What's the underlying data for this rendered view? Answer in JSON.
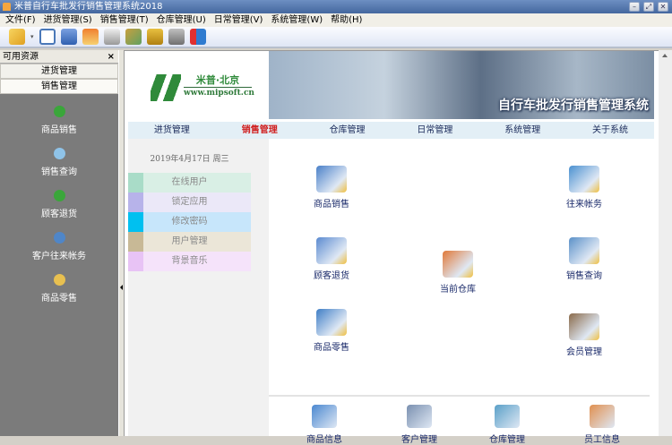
{
  "window": {
    "title": "米普自行车批发行销售管理系统2018",
    "min": "–",
    "max": "⤢",
    "close": "✕"
  },
  "menu": [
    "文件(F)",
    "进货管理(S)",
    "销售管理(T)",
    "仓库管理(U)",
    "日常管理(V)",
    "系统管理(W)",
    "帮助(H)"
  ],
  "toolbar": [
    "open-folder-icon",
    "list-icon",
    "computers-icon",
    "home-icon",
    "printer-icon",
    "keys-icon",
    "lock-icon",
    "user-lock-icon",
    "exit-door-icon"
  ],
  "leftpanel": {
    "title": "可用资源",
    "close": "×",
    "categories": [
      "进货管理",
      "销售管理"
    ],
    "items": [
      {
        "label": "商品销售",
        "color": "#3aa63a"
      },
      {
        "label": "销售查询",
        "color": "#8fc3e8"
      },
      {
        "label": "顾客退货",
        "color": "#3aa63a"
      },
      {
        "label": "客户往来帐务",
        "color": "#4f86c8"
      },
      {
        "label": "商品零售",
        "color": "#e8c050"
      }
    ]
  },
  "logo": {
    "name": "米普·北京",
    "url": "www.mipsoft.cn"
  },
  "banner": {
    "title": "自行车批发行销售管理系统"
  },
  "nav": [
    {
      "label": "进货管理"
    },
    {
      "label": "销售管理",
      "active": true
    },
    {
      "label": "仓库管理"
    },
    {
      "label": "日常管理"
    },
    {
      "label": "系统管理"
    },
    {
      "label": "关于系统"
    }
  ],
  "info": {
    "date": "2019年4月17日  周三",
    "rows": [
      {
        "label": "在线用户",
        "bg": "#d9efe5",
        "strip": "#a9dcc8"
      },
      {
        "label": "锁定应用",
        "bg": "#ebe8f8",
        "strip": "#b7b3ea"
      },
      {
        "label": "修改密码",
        "bg": "#c7e6fb",
        "strip": "#00c0f0"
      },
      {
        "label": "用户管理",
        "bg": "#ebe6d8",
        "strip": "#c8b996"
      },
      {
        "label": "背景音乐",
        "bg": "#f5e3fa",
        "strip": "#e8c3f5"
      }
    ]
  },
  "apps": [
    "商品销售",
    "往来帐务",
    "顾客退货",
    "当前仓库",
    "销售查询",
    "商品零售",
    "会员管理"
  ],
  "bottom_apps": [
    "商品信息",
    "客户管理",
    "仓库管理",
    "员工信息"
  ]
}
